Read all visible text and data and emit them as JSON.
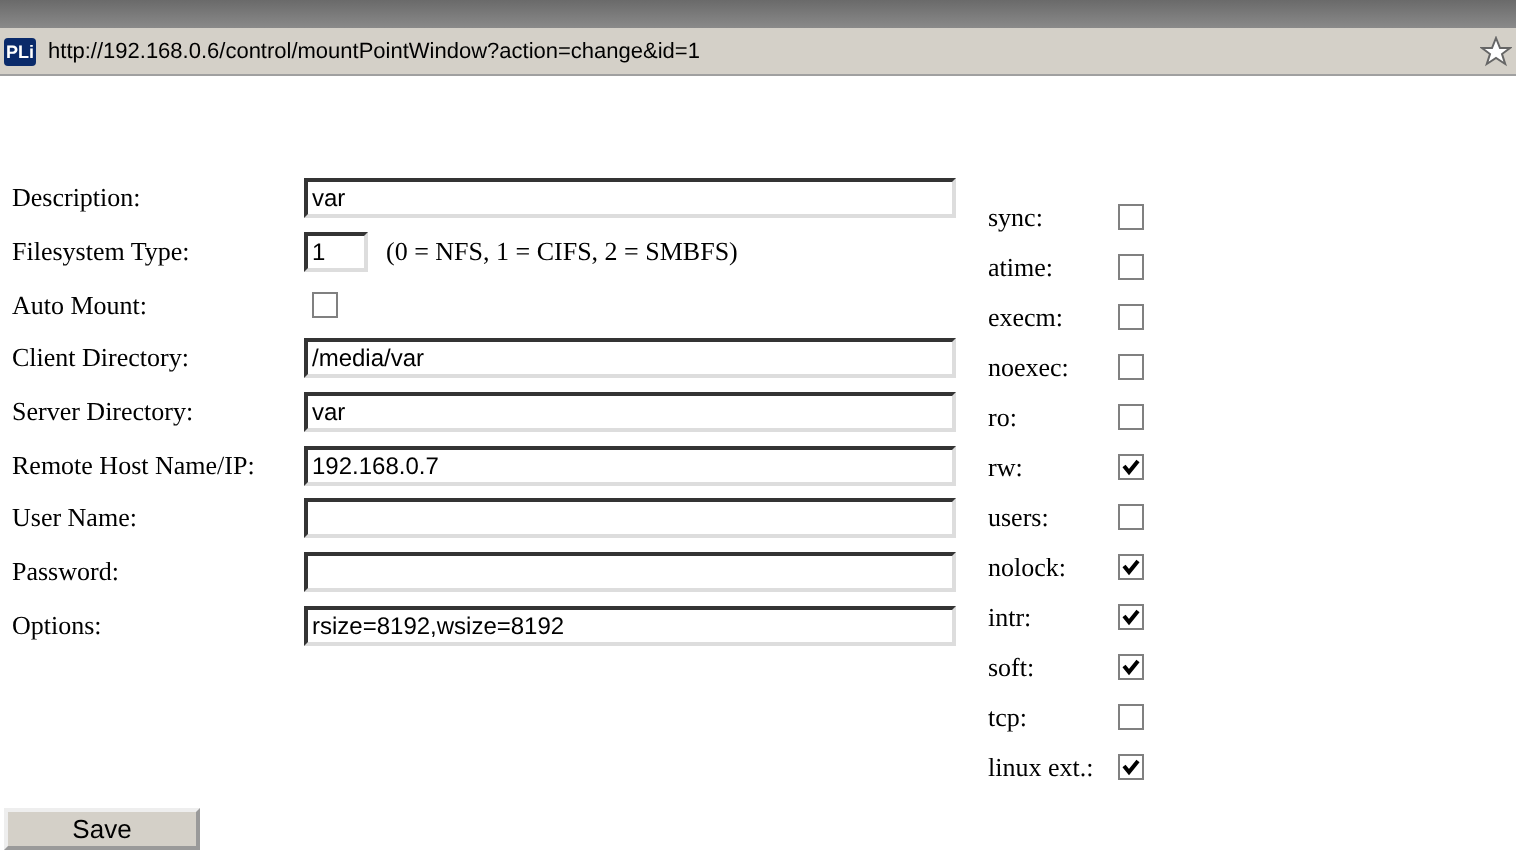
{
  "address_bar": {
    "site_icon": "PLi",
    "url": "http://192.168.0.6/control/mountPointWindow?action=change&id=1"
  },
  "fields": [
    {
      "kind": "text",
      "label": "Description:",
      "value": "var"
    },
    {
      "kind": "short",
      "label": "Filesystem Type:",
      "value": "1",
      "hint": "(0 = NFS, 1 = CIFS, 2 = SMBFS)"
    },
    {
      "kind": "checkbox",
      "label": "Auto Mount:",
      "checked": false
    },
    {
      "kind": "text",
      "label": "Client Directory:",
      "value": "/media/var"
    },
    {
      "kind": "text",
      "label": "Server Directory:",
      "value": "var"
    },
    {
      "kind": "text",
      "label": "Remote Host Name/IP:",
      "value": "192.168.0.7"
    },
    {
      "kind": "text",
      "label": "User Name:"
    },
    {
      "kind": "text",
      "label": "Password:"
    },
    {
      "kind": "text",
      "label": "Options:",
      "value": "rsize=8192,wsize=8192"
    }
  ],
  "options": [
    {
      "label": "sync:",
      "checked": false
    },
    {
      "label": "atime:",
      "checked": false
    },
    {
      "label": "execm:",
      "checked": false
    },
    {
      "label": "noexec:",
      "checked": false
    },
    {
      "label": "ro:",
      "checked": false
    },
    {
      "label": "rw:",
      "checked": true
    },
    {
      "label": "users:",
      "checked": false
    },
    {
      "label": "nolock:",
      "checked": true
    },
    {
      "label": "intr:",
      "checked": true
    },
    {
      "label": "soft:",
      "checked": true
    },
    {
      "label": "tcp:",
      "checked": false
    },
    {
      "label": "linux ext.:",
      "checked": true
    }
  ],
  "save_button": "Save"
}
